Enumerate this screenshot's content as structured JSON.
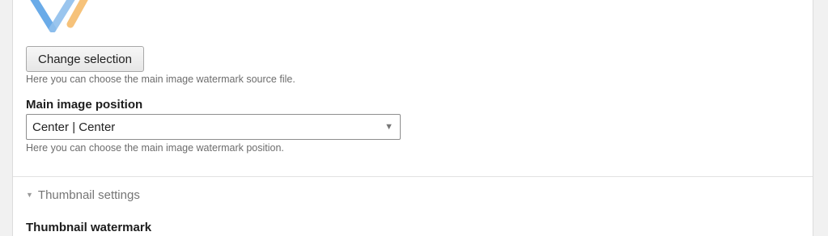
{
  "source": {
    "change_label": "Change selection",
    "help": "Here you can choose the main image watermark source file."
  },
  "position": {
    "label": "Main image position",
    "selected": "Center | Center",
    "help": "Here you can choose the main image watermark position."
  },
  "thumbnail": {
    "summary": "Thumbnail settings",
    "watermark_label": "Thumbnail watermark"
  },
  "colors": {
    "logo_blue": "#6aabe8",
    "logo_orange": "#f6c27a"
  }
}
